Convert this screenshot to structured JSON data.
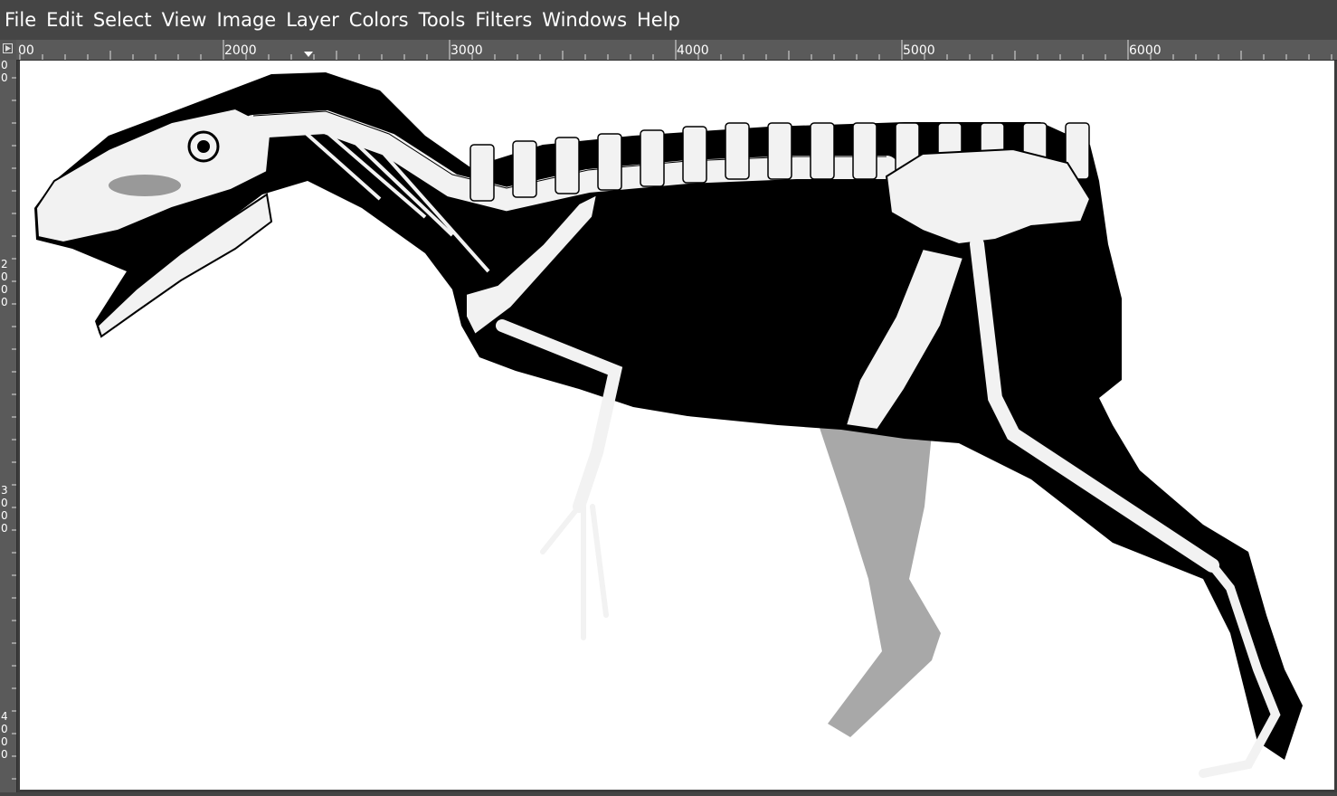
{
  "menu": [
    "File",
    "Edit",
    "Select",
    "View",
    "Image",
    "Layer",
    "Colors",
    "Tools",
    "Filters",
    "Windows",
    "Help"
  ],
  "ruler": {
    "horizontal_labels": [
      "00",
      "2000",
      "3000",
      "4000",
      "5000",
      "6000"
    ],
    "vertical_labels": [
      "0",
      "0",
      "2",
      "0",
      "0",
      "0",
      "3",
      "0",
      "0",
      "0",
      "4",
      "0",
      "0",
      "0"
    ]
  },
  "icons": {
    "ruler_corner": "quick-mask-toggle-icon",
    "ruler_pointer": "cursor-position-marker-icon"
  },
  "colors": {
    "menubar_bg": "#454545",
    "ruler_bg": "#5a5a5a",
    "canvas_bg": "#ffffff",
    "silhouette": "#000000",
    "bone": "#f2f2f2",
    "shadow_leg": "#a8a8a8"
  }
}
